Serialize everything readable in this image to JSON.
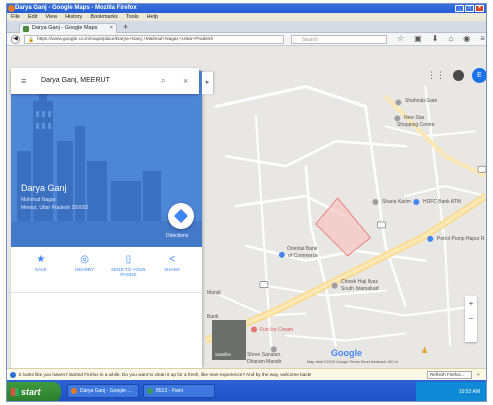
{
  "window": {
    "title": "Darya Ganj - Google Maps - Mozilla Firefox"
  },
  "menu": [
    "File",
    "Edit",
    "View",
    "History",
    "Bookmarks",
    "Tools",
    "Help"
  ],
  "browser": {
    "tab_title": "Darya Ganj - Google Maps",
    "url": "https://www.google.co.in/maps/place/Darya+Ganj,+Malimul+Nagar,+Uttar+Pradesh",
    "search_placeholder": "Search"
  },
  "maps": {
    "search_value": "Darya Ganj, MEERUT",
    "place": {
      "name": "Darya Ganj",
      "address1": "Mahmud Nagar",
      "address2": "Meerut, Uttar Pradesh 250002"
    },
    "directions_label": "Directions",
    "actions": [
      {
        "icon": "bookmark-icon",
        "label": "SAVE"
      },
      {
        "icon": "nearby-icon",
        "label": "NEARBY"
      },
      {
        "icon": "phone-icon",
        "label": "SEND TO YOUR PHONE"
      },
      {
        "icon": "share-icon",
        "label": "SHARE"
      }
    ],
    "labels": {
      "shahnab_gate": "Shahnab Gate",
      "new_star": "New Star",
      "shopping_centre": "Shopping Centre",
      "sharia_karim": "Sharia Karim",
      "hdfc": "HDFC Bank ATM",
      "petrol": "Petrol Pump Hapur R",
      "oriental1": "Oriental Bank",
      "oriental2": "of Commerce",
      "chowk1": "Chowk Haji Ilyas",
      "chowk2": "South Islamabad",
      "mandi": "Mandi",
      "bank": "Bank",
      "fun": "Fun Ice Cream",
      "shree1": "Shree Sanatan",
      "shree2": "Dharam Mandir"
    },
    "satellite_label": "Satellite",
    "google_logo": "Google",
    "attribution": "Map data ©2015 Google   Terms   Send feedback   100 m",
    "avatar_letter": "E"
  },
  "notification": {
    "text": "It looks like you haven't started Firefox in a while. Do you want to clean it up for a fresh, like-new experience? And by the way, welcome back!",
    "button": "Refresh Firefox..."
  },
  "taskbar": {
    "start": "start",
    "tasks": [
      "Darya Ganj - Google ...",
      "8513 - Paint"
    ],
    "clock": "10:52 AM"
  },
  "colors": {
    "panel_header": "#4e86d6",
    "accent": "#4285f4",
    "highlight": "#f4c7c2"
  }
}
